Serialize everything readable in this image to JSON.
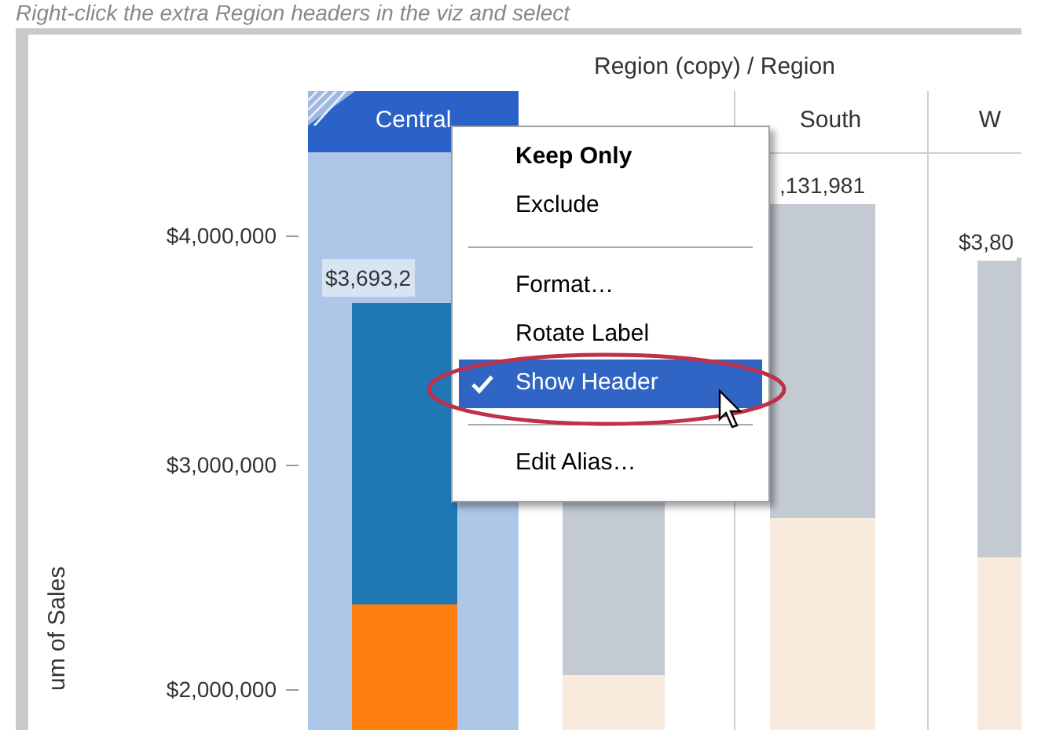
{
  "caption": "Right-click the extra Region headers in the viz and select",
  "chart": {
    "title": "Region (copy) / Region",
    "axis_label": "um of Sales",
    "y_ticks": [
      "$4,000,000",
      "$3,000,000",
      "$2,000,000"
    ],
    "columns": [
      {
        "header": "Central",
        "selected": true,
        "bar_label": "$3,693,2"
      },
      {
        "selected": false
      },
      {
        "header": "South",
        "selected": false,
        "bar_label": ",131,981"
      },
      {
        "header": "W",
        "selected": false,
        "bar_label": "$3,80"
      }
    ]
  },
  "context_menu": {
    "items": [
      {
        "kind": "item",
        "label": "Keep Only",
        "bold": true,
        "checked": false,
        "selected": false
      },
      {
        "kind": "item",
        "label": "Exclude",
        "bold": false,
        "checked": false,
        "selected": false
      },
      {
        "kind": "separator"
      },
      {
        "kind": "item",
        "label": "Format…",
        "bold": false,
        "checked": false,
        "selected": false
      },
      {
        "kind": "item",
        "label": "Rotate Label",
        "bold": false,
        "checked": false,
        "selected": false
      },
      {
        "kind": "item",
        "label": "Show Header",
        "bold": false,
        "checked": true,
        "selected": true
      },
      {
        "kind": "separator"
      },
      {
        "kind": "item",
        "label": "Edit Alias…",
        "bold": false,
        "checked": false,
        "selected": false
      }
    ]
  }
}
